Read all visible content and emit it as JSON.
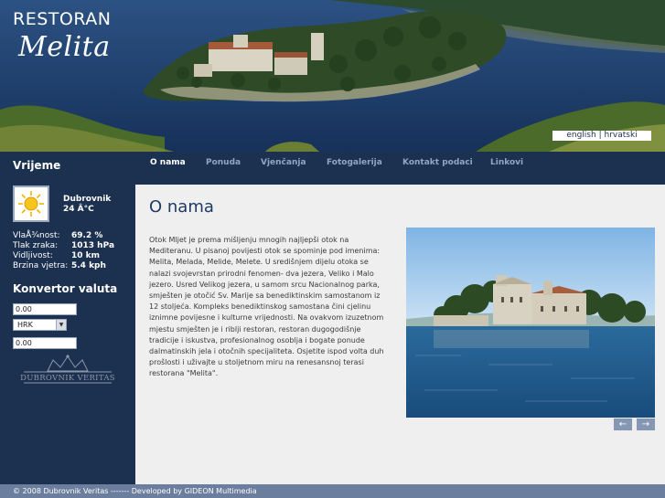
{
  "header": {
    "logo_line1": "RESTORAN",
    "logo_line2": "Melita",
    "lang_english": "english",
    "lang_separator": "|",
    "lang_hrvatski": "hrvatski"
  },
  "sidebar": {
    "weather_title": "Vrijeme",
    "city": "Dubrovnik",
    "temperature": "24 Â°C",
    "weather_icon": "sun-icon",
    "stats": [
      {
        "label": "VlaÅ¾nost:",
        "value": "69.2 %"
      },
      {
        "label": "Tlak zraka:",
        "value": "1013 hPa"
      },
      {
        "label": "Vidljivost:",
        "value": "10 km"
      },
      {
        "label": "Brzina vjetra:",
        "value": "5.4 kph"
      }
    ],
    "converter_title": "Konvertor valuta",
    "converter_input1": "0.00",
    "currency_selected": "HRK",
    "converter_input2": "0.00",
    "partner_logo_text": "DUBROVNIK VERITAS"
  },
  "nav": {
    "items": [
      "O nama",
      "Ponuda",
      "Vjenčanja",
      "Fotogalerija",
      "Kontakt podaci",
      "Linkovi"
    ],
    "active": "O nama"
  },
  "main": {
    "title": "O nama",
    "body": "Otok Mljet je prema mišljenju mnogih najljepši otok na Mediteranu. U pisanoj povijesti otok se spominje pod imenima: Melita, Melada, Melide, Melete. U središnjem dijelu otoka se nalazi svojevrstan prirodni fenomen- dva jezera, Veliko i Malo jezero. Usred Velikog jezera, u samom srcu Nacionalnog parka, smješten je otočić Sv. Marije sa benediktinskim samostanom iz 12 stoljeća. Kompleks benediktinskog samostana čini cjelinu iznimne povijesne i kulturne vrijednosti. Na ovakvom izuzetnom mjestu smješten je i riblji restoran, restoran dugogodišnje tradicije i iskustva, profesionalnog osoblja i bogate ponude dalmatinskih jela i otočnih specijaliteta. Osjetite ispod volta duh prošlosti i uživajte u stoljetnom miru na renesansnoj terasi restorana \"Melita\".",
    "prev_icon": "arrow-left-icon",
    "prev_glyph": "←",
    "next_icon": "arrow-right-icon",
    "next_glyph": "→"
  },
  "footer": {
    "text": "© 2008 Dubrovnik Veritas ------- Developed by GIDEON Multimedia"
  },
  "colors": {
    "sidebar_bg": "#1c3050",
    "main_bg": "#efefef",
    "title_color": "#1e3a63",
    "footer_bg": "#6b7e9e",
    "nav_inactive": "#8fa6c5",
    "arrow_btn": "#8597b3"
  }
}
